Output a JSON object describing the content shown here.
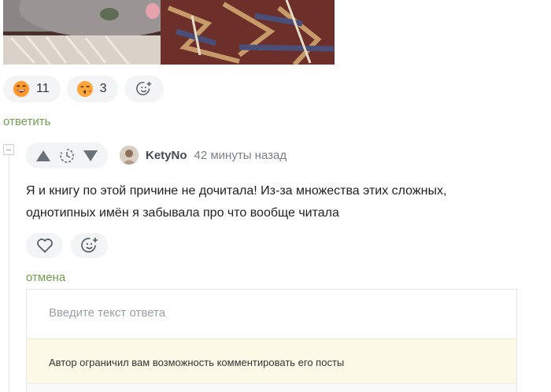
{
  "post_reactions": [
    {
      "icon": "laughing-face-icon",
      "count": "11"
    },
    {
      "icon": "kiss-face-icon",
      "count": "3"
    }
  ],
  "add_reaction_icon": "add-emoji-icon",
  "reply_label": "ответить",
  "comment": {
    "author": "KetyNo",
    "time": "42 минуты назад",
    "text": "Я и книгу по этой причине не дочитала! Из-за множества этих сложных, однотипных имён я забывала про что вообще читала"
  },
  "cancel_label": "отмена",
  "reply_editor": {
    "placeholder": "Введите текст ответа",
    "notice": "Автор ограничил вам возможность комментировать его посты"
  },
  "colors": {
    "link_green": "#6f9f4f",
    "pill_bg": "#f3f4f6",
    "notice_bg": "#fcf9e6"
  }
}
